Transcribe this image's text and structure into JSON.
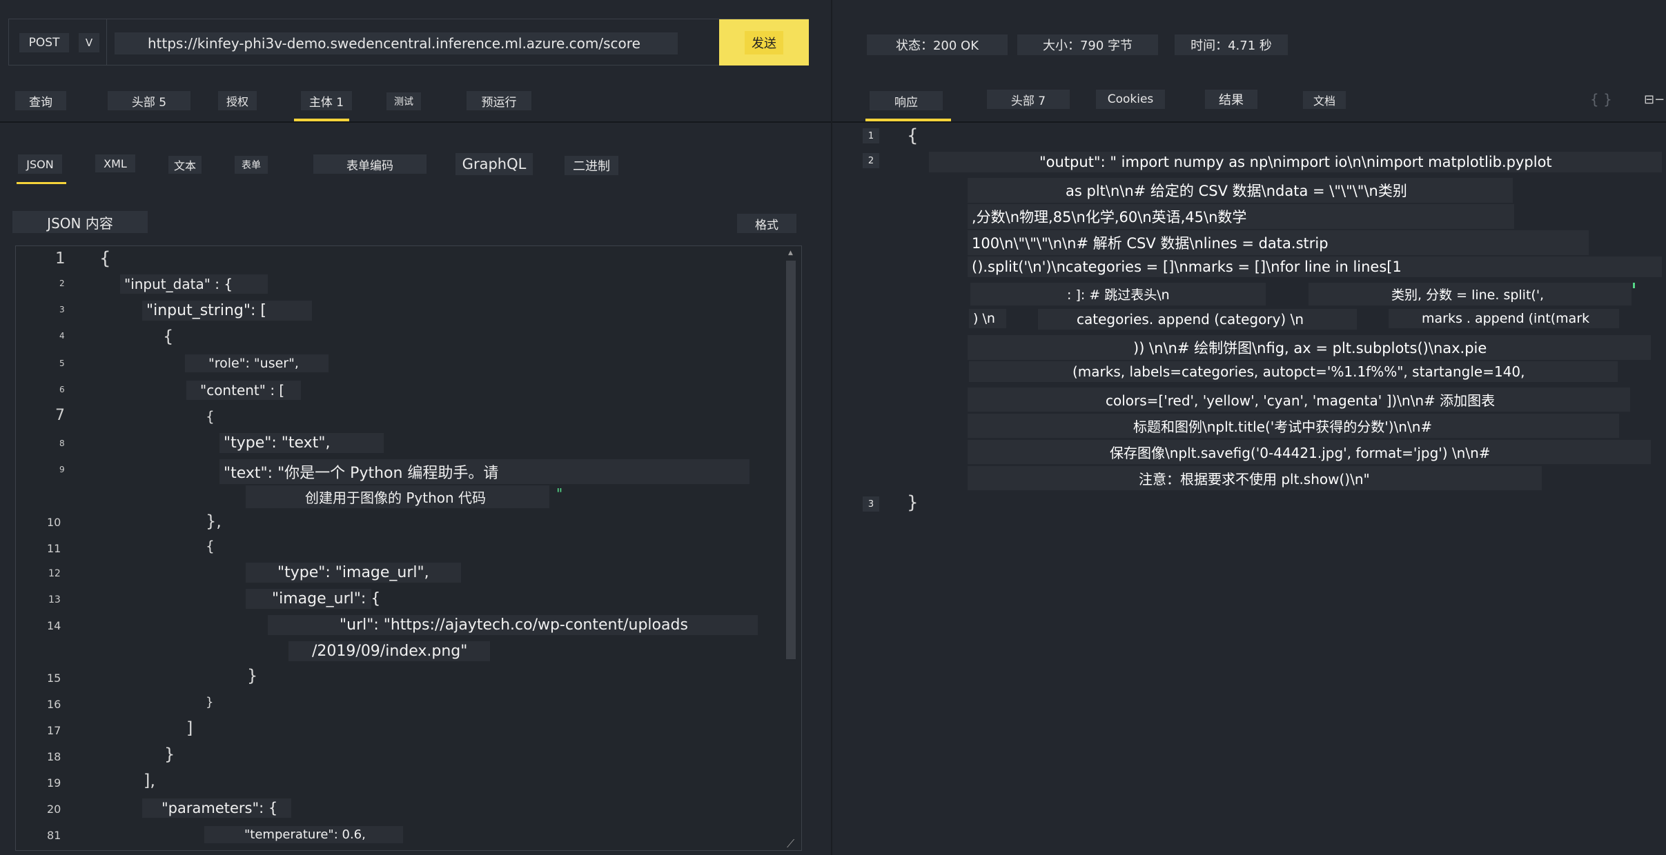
{
  "request": {
    "method": "POST",
    "method_dropdown": "V",
    "url": "https://kinfey-phi3v-demo.swedencentral.inference.ml.azure.com/score",
    "send_label": "发送"
  },
  "request_tabs": [
    "查询",
    "头部 5",
    "授权",
    "主体 1",
    "测试",
    "预运行"
  ],
  "body_tabs": [
    "JSON",
    "XML",
    "文本",
    "表单",
    "表单编码",
    "GraphQL",
    "二进制"
  ],
  "json_content_label": "JSON 内容",
  "format_label": "格式",
  "editor": {
    "line_numbers": [
      "1",
      "2",
      "3",
      "4",
      "5",
      "6",
      "7",
      "8",
      "9",
      "10",
      "11",
      "12",
      "13",
      "14",
      "15",
      "16",
      "17",
      "18",
      "19",
      "20",
      "81"
    ],
    "lines": {
      "l1": "{",
      "l2": "\"input_data\" : {",
      "l3": "\"input_string\": [",
      "l4": "{",
      "l5": "\"role\": \"user\",",
      "l6": "\"content\" : [",
      "l7": "{",
      "l8": "\"type\": \"text\",",
      "l9a": "\"text\": \"你是一个 Python 编程助手。请",
      "l9b": "创建用于图像的 Python 代码",
      "l9c": "\"",
      "l10": "},",
      "l11": "{",
      "l12": "\"type\": \"image_url\",",
      "l13": "\"image_url\": {",
      "l14a": "\"url\": \"https://ajaytech.co/wp-content/uploads",
      "l14b": "/2019/09/index.png\"",
      "l15": "}",
      "l16": "}",
      "l17": "]",
      "l18": "}",
      "l19": "],",
      "l20": "\"parameters\": {",
      "l21": "\"temperature\": 0.6,"
    }
  },
  "status": {
    "status": "状态：200 OK",
    "size": "大小：790 字节",
    "time": "时间：4.71 秒"
  },
  "response_tabs": [
    "响应",
    "头部 7",
    "Cookies",
    "结果",
    "文档"
  ],
  "response_icons": {
    "braces": "{ }",
    "menu": "⊟−"
  },
  "response": {
    "line_numbers": [
      "1",
      "2",
      "3"
    ],
    "open": "{",
    "close": "}",
    "lines": [
      "\"output\": \" import numpy as np\\nimport io\\n\\nimport matplotlib.pyplot",
      "as plt\\n\\n# 给定的 CSV 数据\\ndata = \\\"\\\"\\\"\\n类别",
      ",分数\\n物理,85\\n化学,60\\n英语,45\\n数学",
      "100\\n\\\"\\\"\\\"\\n\\n# 解析 CSV 数据\\nlines = data.strip",
      "().split('\\n')\\ncategories = []\\nmarks = []\\nfor line in lines[1",
      ": ]: # 跳过表头\\n",
      "类别, 分数 = line. split(',",
      ") \\n",
      "categories. append (category) \\n",
      "marks . append (int(mark",
      ")) \\n\\n# 绘制饼图\\nfig, ax = plt.subplots()\\nax.pie",
      "(marks, labels=categories, autopct='%1.1f%%\", startangle=140,",
      "colors=['red', 'yellow', 'cyan', 'magenta' ])\\n\\n# 添加图表",
      "标题和图例\\nplt.title('考试中获得的分数')\\n\\n#",
      "保存图像\\nplt.savefig('0-44421.jpg', format='jpg') \\n\\n#",
      "注意：根据要求不使用 plt.show()\\n\""
    ]
  },
  "colors": {
    "background": "#23272e",
    "accent": "#f5d33a",
    "send_button": "#f5e05a",
    "chip": "#2e333b"
  }
}
